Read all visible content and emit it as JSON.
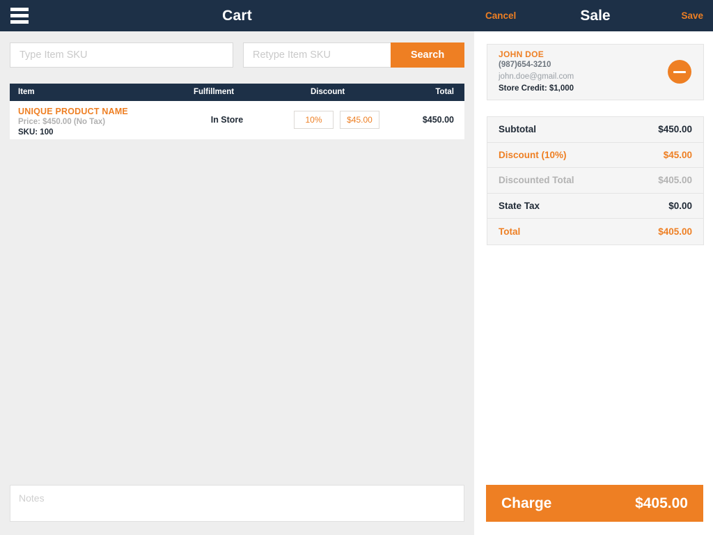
{
  "colors": {
    "navy": "#1d3047",
    "orange": "#ee7f23",
    "panel_bg": "#eeeeee",
    "card_bg": "#f5f5f5",
    "muted": "#b3b3b3"
  },
  "topbar": {
    "menu_icon": "hamburger-menu-icon",
    "cart_title": "Cart",
    "cancel_label": "Cancel",
    "sale_title": "Sale",
    "save_label": "Save"
  },
  "search": {
    "sku_placeholder": "Type Item SKU",
    "sku_value": "",
    "retype_placeholder": "Retype Item SKU",
    "retype_value": "",
    "search_label": "Search"
  },
  "cart": {
    "columns": {
      "item": "Item",
      "fulfillment": "Fulfillment",
      "discount": "Discount",
      "total": "Total"
    },
    "rows": [
      {
        "name": "UNIQUE PRODUCT NAME",
        "price": "Price: $450.00 (No Tax)",
        "sku": "SKU: 100",
        "fulfillment": "In Store",
        "discount_percent": "10%",
        "discount_amount": "$45.00",
        "total": "$450.00"
      }
    ]
  },
  "notes": {
    "placeholder": "Notes",
    "value": ""
  },
  "customer": {
    "name": "JOHN DOE",
    "phone": "(987)654-3210",
    "email": "john.doe@gmail.com",
    "store_credit": "Store Credit: $1,000",
    "remove_icon": "minus-circle-icon"
  },
  "totals": [
    {
      "label": "Subtotal",
      "value": "$450.00",
      "tone": "dark"
    },
    {
      "label": "Discount (10%)",
      "value": "$45.00",
      "tone": "orange"
    },
    {
      "label": "Discounted Total",
      "value": "$405.00",
      "tone": "muted"
    },
    {
      "label": "State Tax",
      "value": "$0.00",
      "tone": "dark"
    },
    {
      "label": "Total",
      "value": "$405.00",
      "tone": "orange"
    }
  ],
  "charge": {
    "label": "Charge",
    "amount": "$405.00"
  }
}
